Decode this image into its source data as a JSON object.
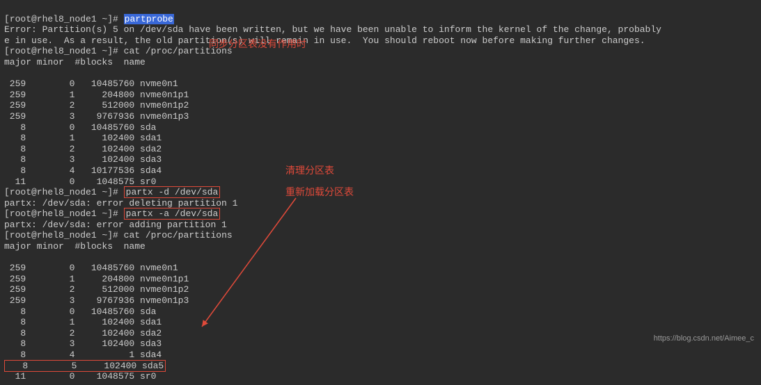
{
  "prompt1": "[root@rhel8_node1 ~]# ",
  "cmd1": "partprobe",
  "error1": "Error: Partition(s) 5 on /dev/sda have been written, but we have been unable to inform the kernel of the change, probably",
  "error2": "e in use.  As a result, the old partition(s) will remain in use.  You should reboot now before making further changes.",
  "prompt2": "[root@rhel8_node1 ~]# ",
  "cmd2": "cat /proc/partitions",
  "header": "major minor  #blocks  name",
  "rows1": [
    " 259        0   10485760 nvme0n1",
    " 259        1     204800 nvme0n1p1",
    " 259        2     512000 nvme0n1p2",
    " 259        3    9767936 nvme0n1p3",
    "   8        0   10485760 sda",
    "   8        1     102400 sda1",
    "   8        2     102400 sda2",
    "   8        3     102400 sda3",
    "   8        4   10177536 sda4",
    "  11        0    1048575 sr0"
  ],
  "prompt3": "[root@rhel8_node1 ~]# ",
  "cmd3": "partx -d /dev/sda",
  "err3": "partx: /dev/sda: error deleting partition 1",
  "prompt4": "[root@rhel8_node1 ~]# ",
  "cmd4": "partx -a /dev/sda",
  "err4": "partx: /dev/sda: error adding partition 1",
  "prompt5": "[root@rhel8_node1 ~]# ",
  "cmd5": "cat /proc/partitions",
  "rows2": [
    " 259        0   10485760 nvme0n1",
    " 259        1     204800 nvme0n1p1",
    " 259        2     512000 nvme0n1p2",
    " 259        3    9767936 nvme0n1p3",
    "   8        0   10485760 sda",
    "   8        1     102400 sda1",
    "   8        2     102400 sda2",
    "   8        3     102400 sda3",
    "   8        4          1 sda4"
  ],
  "row_new": "   8        5     102400 sda5",
  "row_last": "  11        0    1048575 sr0",
  "anno1": "同步分区表没有作用时",
  "anno2": "清理分区表",
  "anno3": "重新加载分区表",
  "watermark": "https://blog.csdn.net/Aimee_c"
}
